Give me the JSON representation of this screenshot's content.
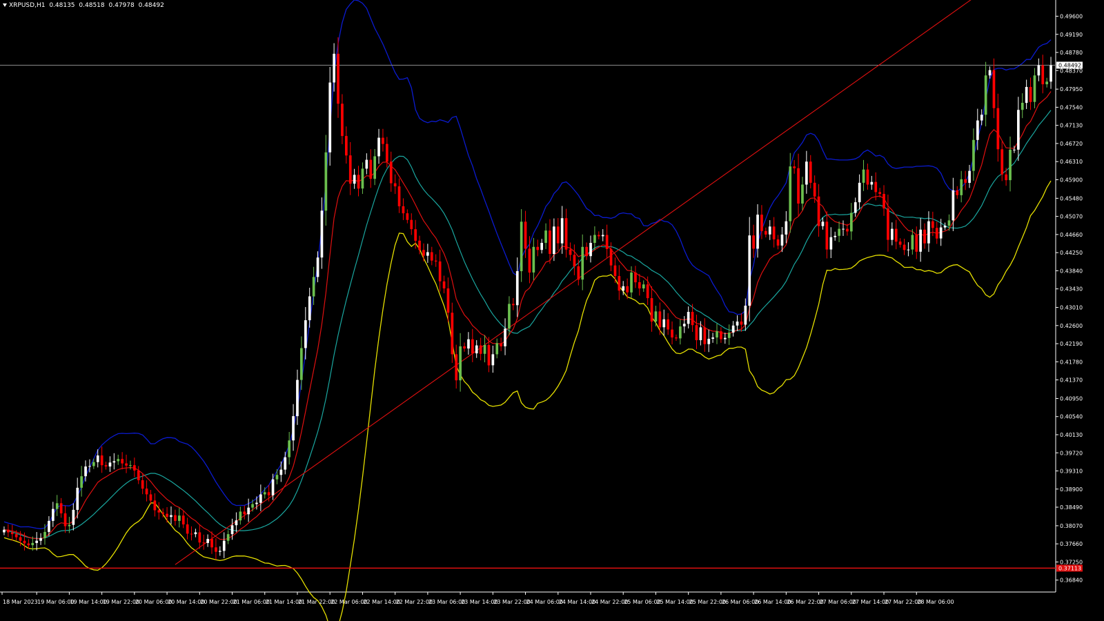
{
  "header": {
    "symbol": "XRPUSD,H1",
    "open": "0.48135",
    "high": "0.48518",
    "low": "0.47978",
    "close": "0.48492"
  },
  "colors": {
    "background": "#000000",
    "bull_candle": "#ffffff",
    "bull_candle_alt": "#6bbf4e",
    "bear_candle": "#ff0000",
    "upper_band": "#0b1bd0",
    "lower_band": "#e6e000",
    "middle_band": "#1aa7a0",
    "fast_ma": "#e01010",
    "trendline": "#e01010",
    "support_line": "#e01010",
    "price_line": "#8a8a8a",
    "text": "#ffffff"
  },
  "chart_data": {
    "type": "candlestick",
    "ylim": [
      0.3657,
      0.4992
    ],
    "grid": false,
    "y_ticks": [
      "0.49600",
      "0.49190",
      "0.48780",
      "0.48370",
      "0.47950",
      "0.47540",
      "0.47130",
      "0.46720",
      "0.46310",
      "0.45900",
      "0.45480",
      "0.45070",
      "0.44660",
      "0.44250",
      "0.43840",
      "0.43430",
      "0.43010",
      "0.42600",
      "0.42190",
      "0.41780",
      "0.41370",
      "0.40950",
      "0.40540",
      "0.40130",
      "0.39720",
      "0.39310",
      "0.38900",
      "0.38490",
      "0.38070",
      "0.37660",
      "0.37250",
      "0.36840"
    ],
    "x_ticks": [
      "18 Mar 2023",
      "19 Mar 06:00",
      "19 Mar 14:00",
      "19 Mar 22:00",
      "20 Mar 06:00",
      "20 Mar 14:00",
      "20 Mar 22:00",
      "21 Mar 06:00",
      "21 Mar 14:00",
      "21 Mar 22:00",
      "22 Mar 06:00",
      "22 Mar 14:00",
      "22 Mar 22:00",
      "23 Mar 06:00",
      "23 Mar 14:00",
      "23 Mar 22:00",
      "24 Mar 06:00",
      "24 Mar 14:00",
      "24 Mar 22:00",
      "25 Mar 06:00",
      "25 Mar 14:00",
      "25 Mar 22:00",
      "26 Mar 06:00",
      "26 Mar 14:00",
      "26 Mar 22:00",
      "27 Mar 06:00",
      "27 Mar 14:00",
      "27 Mar 22:00",
      "28 Mar 06:00"
    ],
    "current_price": "0.48492",
    "current_price_value": 0.48492,
    "support_label": "0.37113",
    "support_value": 0.3711,
    "trendline": [
      {
        "bar": 42,
        "price": 0.3719
      },
      {
        "bar": 230,
        "price": 0.4949
      }
    ],
    "closes": [
      0.3798,
      0.3792,
      0.3788,
      0.3781,
      0.3773,
      0.3767,
      0.3763,
      0.3768,
      0.3773,
      0.3779,
      0.3793,
      0.3818,
      0.3845,
      0.3858,
      0.3835,
      0.3806,
      0.3809,
      0.3843,
      0.3893,
      0.3919,
      0.3941,
      0.3942,
      0.3951,
      0.3966,
      0.3944,
      0.3941,
      0.395,
      0.3953,
      0.3958,
      0.3948,
      0.3943,
      0.3944,
      0.3932,
      0.391,
      0.3891,
      0.3878,
      0.3864,
      0.3842,
      0.3837,
      0.3834,
      0.3827,
      0.3831,
      0.3818,
      0.383,
      0.381,
      0.3789,
      0.3788,
      0.3792,
      0.3769,
      0.3768,
      0.3777,
      0.3758,
      0.3748,
      0.375,
      0.3773,
      0.3788,
      0.3808,
      0.3819,
      0.3839,
      0.3833,
      0.3848,
      0.3856,
      0.3859,
      0.3878,
      0.3883,
      0.3876,
      0.3912,
      0.3922,
      0.3934,
      0.3962,
      0.4,
      0.4055,
      0.4137,
      0.4209,
      0.4272,
      0.4326,
      0.437,
      0.4414,
      0.452,
      0.4652,
      0.481,
      0.4875,
      0.4762,
      0.4689,
      0.4645,
      0.4581,
      0.4601,
      0.457,
      0.4615,
      0.4635,
      0.4592,
      0.4643,
      0.4685,
      0.4671,
      0.4631,
      0.4582,
      0.4575,
      0.453,
      0.4514,
      0.4499,
      0.4478,
      0.4452,
      0.4431,
      0.4418,
      0.4426,
      0.4407,
      0.4405,
      0.436,
      0.4344,
      0.4289,
      0.4195,
      0.4136,
      0.4213,
      0.4208,
      0.4229,
      0.4197,
      0.4215,
      0.4196,
      0.4216,
      0.417,
      0.4195,
      0.422,
      0.4213,
      0.4253,
      0.4309,
      0.4306,
      0.4383,
      0.4495,
      0.4434,
      0.438,
      0.4438,
      0.4431,
      0.4447,
      0.4475,
      0.4422,
      0.4484,
      0.4446,
      0.4503,
      0.4432,
      0.442,
      0.4394,
      0.4364,
      0.4438,
      0.4417,
      0.4447,
      0.4465,
      0.4462,
      0.4465,
      0.4433,
      0.4396,
      0.4372,
      0.4339,
      0.4349,
      0.4335,
      0.438,
      0.4358,
      0.4344,
      0.4353,
      0.4322,
      0.4269,
      0.4292,
      0.4256,
      0.4274,
      0.4251,
      0.4233,
      0.4231,
      0.4258,
      0.4264,
      0.4291,
      0.4261,
      0.4227,
      0.4256,
      0.4218,
      0.423,
      0.4233,
      0.4247,
      0.4229,
      0.4232,
      0.4244,
      0.426,
      0.4269,
      0.4262,
      0.4305,
      0.4464,
      0.4434,
      0.4511,
      0.4474,
      0.4466,
      0.4484,
      0.4455,
      0.4441,
      0.4466,
      0.4496,
      0.462,
      0.4616,
      0.4536,
      0.4579,
      0.4631,
      0.4583,
      0.4552,
      0.4485,
      0.4495,
      0.4432,
      0.446,
      0.4463,
      0.4479,
      0.4479,
      0.4473,
      0.4515,
      0.4539,
      0.4583,
      0.4613,
      0.4579,
      0.4585,
      0.4562,
      0.4558,
      0.4525,
      0.4454,
      0.4479,
      0.445,
      0.4443,
      0.4431,
      0.4432,
      0.4465,
      0.4427,
      0.4477,
      0.4446,
      0.4496,
      0.4481,
      0.4457,
      0.4482,
      0.4486,
      0.4498,
      0.4566,
      0.4555,
      0.4591,
      0.4583,
      0.461,
      0.468,
      0.4724,
      0.4737,
      0.4826,
      0.4838,
      0.4752,
      0.4659,
      0.4602,
      0.4589,
      0.4658,
      0.4658,
      0.4748,
      0.4764,
      0.48,
      0.4766,
      0.4826,
      0.4849,
      0.4806,
      0.4812,
      0.4849
    ]
  }
}
